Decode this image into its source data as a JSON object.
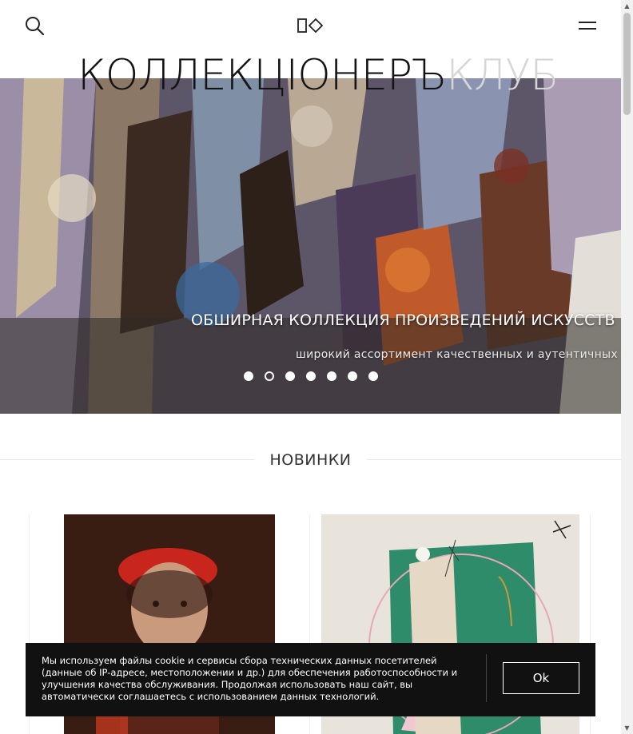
{
  "header": {
    "brand_dark": "КОЛЛЕКЦІОНЕРЪ",
    "brand_light": "КЛУБ",
    "search_icon": "search-icon",
    "menu_icon": "hamburger-menu-icon",
    "logo_icon": "brand-logo-icon"
  },
  "hero": {
    "title": "ОБШИРНАЯ КОЛЛЕКЦИЯ ПРОИЗВЕДЕНИЙ ИСКУССТВ",
    "subtitle": "широкий ассортимент качественных и аутентичных про",
    "slides_count": 7,
    "active_slide": 2
  },
  "section": {
    "title": "НОВИНКИ"
  },
  "cookie": {
    "text": "Мы используем файлы cookie и сервисы сбора технических данных посетителей (данные об IP-адресе, местоположении и др.) для обеспечения работоспособности и улучшения качества обслуживания. Продолжая использовать наш сайт, вы автоматически соглашаетесь с использованием данных технологий.",
    "button": "Ok"
  },
  "colors": {
    "brand_dark": "#141414",
    "brand_light": "#d6d6d6",
    "cookie_bg": "#111111"
  }
}
